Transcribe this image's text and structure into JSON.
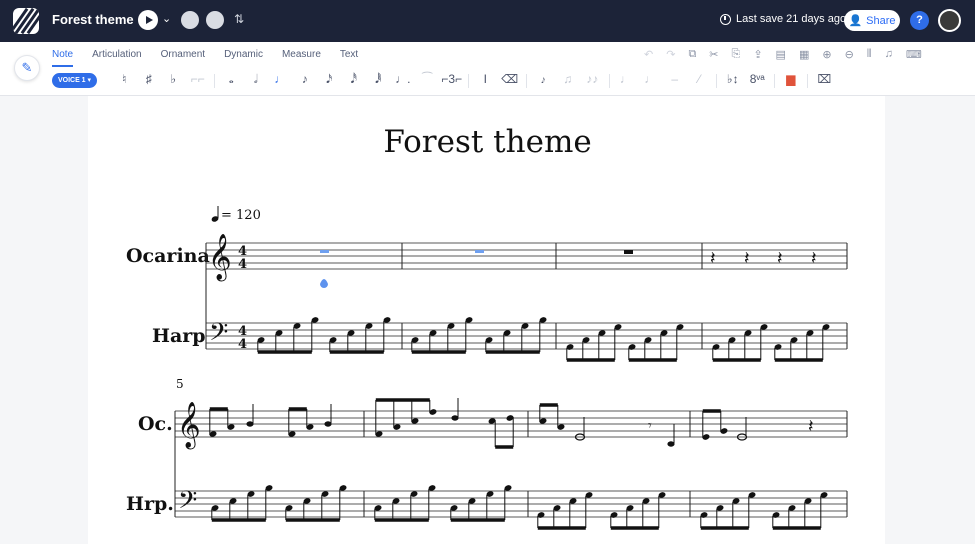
{
  "app": {
    "document_title": "Forest theme",
    "last_save": "Last save 21 days ago",
    "share_label": "Share",
    "help_label": "?"
  },
  "toolbar": {
    "tabs": [
      {
        "label": "Note",
        "active": true
      },
      {
        "label": "Articulation",
        "active": false
      },
      {
        "label": "Ornament",
        "active": false
      },
      {
        "label": "Dynamic",
        "active": false
      },
      {
        "label": "Measure",
        "active": false
      },
      {
        "label": "Text",
        "active": false
      }
    ],
    "voice_label": "VOICE 1 ▾",
    "accent_color": "#2f6de8"
  },
  "score": {
    "title": "Forest theme",
    "tempo": "= 120",
    "instruments_full": [
      "Ocarina",
      "Harp"
    ],
    "instruments_short": [
      "Oc.",
      "Hrp."
    ],
    "second_system_measure_number": "5",
    "time_signature": "4/4"
  }
}
